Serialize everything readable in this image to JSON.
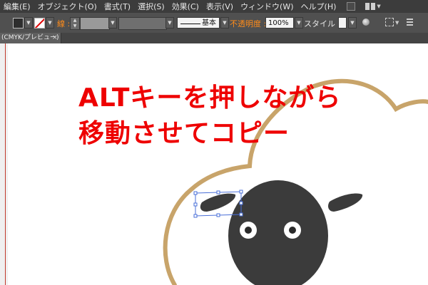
{
  "menu": {
    "items": [
      "編集(E)",
      "オブジェクト(O)",
      "書式(T)",
      "選択(S)",
      "効果(C)",
      "表示(V)",
      "ウィンドウ(W)",
      "ヘルプ(H)"
    ]
  },
  "control_bar": {
    "stroke_label": "線 :",
    "stroke_style": "基本",
    "opacity_label": "不透明度 :",
    "opacity_value": "100%",
    "style_label": "スタイル :"
  },
  "document_tab": {
    "title": "(CMYK/プレビュー)",
    "close": "×"
  },
  "canvas": {
    "overlay_line1": "ALTキーを押しながら",
    "overlay_line2": "移動させてコピー"
  },
  "colors": {
    "overlay_text": "#ee0000",
    "cloud_outline": "#c8a46a",
    "sheep_face": "#3b3b3b",
    "selection": "#4a6fd8",
    "accent_label": "#ff8c1a"
  }
}
